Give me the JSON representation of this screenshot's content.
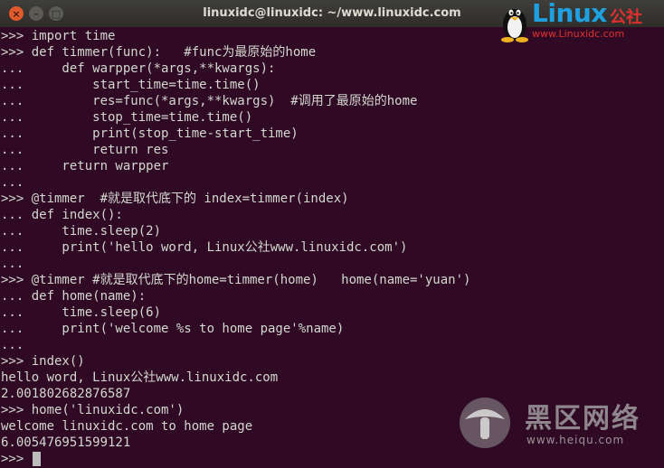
{
  "window": {
    "title": "linuxidc@linuxidc: ~/www.linuxidc.com",
    "close_label": "×",
    "minimize_label": "–",
    "maximize_label": "□"
  },
  "terminal": {
    "lines": [
      ">>> import time",
      ">>> def timmer(func):   #func为最原始的home",
      "...     def warpper(*args,**kwargs):",
      "...         start_time=time.time()",
      "...         res=func(*args,**kwargs)  #调用了最原始的home",
      "...         stop_time=time.time()",
      "...         print(stop_time-start_time)",
      "...         return res",
      "...     return warpper",
      "...",
      ">>> @timmer  #就是取代底下的 index=timmer(index)",
      "... def index():",
      "...     time.sleep(2)",
      "...     print('hello word, Linux公社www.linuxidc.com')",
      "...",
      ">>> @timmer #就是取代底下的home=timmer(home)   home(name='yuan')",
      "... def home(name):",
      "...     time.sleep(6)",
      "...     print('welcome %s to home page'%name)",
      "...",
      ">>> index()",
      "hello word, Linux公社www.linuxidc.com",
      "2.001802682876587",
      ">>> home('linuxidc.com')",
      "welcome linuxidc.com to home page",
      "6.005476951599121"
    ],
    "prompt": ">>> "
  },
  "watermarks": {
    "linux_word": "Linux",
    "linux_cn": "公社",
    "linux_url": "www.Linuxidc.com",
    "heiqu_name": "黑区网络",
    "heiqu_url": "www.heiqu.com"
  },
  "colors": {
    "terminal_bg": "#300a24",
    "terminal_fg": "#d3d7cf",
    "titlebar": "#3c3b37",
    "close_button": "#e05a2b"
  }
}
